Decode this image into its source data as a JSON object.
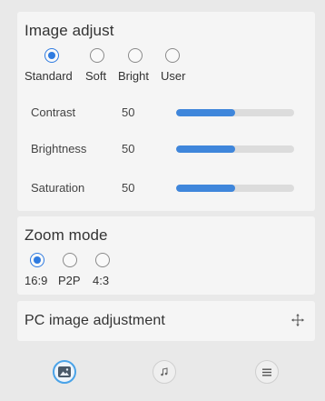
{
  "image_adjust": {
    "title": "Image adjust",
    "presets": [
      {
        "label": "Standard",
        "checked": true
      },
      {
        "label": "Soft",
        "checked": false
      },
      {
        "label": "Bright",
        "checked": false
      },
      {
        "label": "User",
        "checked": false
      }
    ],
    "sliders": [
      {
        "label": "Contrast",
        "value": "50",
        "fill_fraction": 0.5
      },
      {
        "label": "Brightness",
        "value": "50",
        "fill_fraction": 0.5
      },
      {
        "label": "Saturation",
        "value": "50",
        "fill_fraction": 0.5
      }
    ]
  },
  "zoom_mode": {
    "title": "Zoom mode",
    "options": [
      {
        "label": "16:9",
        "checked": true
      },
      {
        "label": "P2P",
        "checked": false
      },
      {
        "label": "4:3",
        "checked": false
      }
    ]
  },
  "pc_adjust": {
    "title": "PC image adjustment",
    "icon": "move-icon"
  },
  "bottom_tabs": [
    {
      "icon": "image-icon",
      "active": true
    },
    {
      "icon": "music-icon",
      "active": false
    },
    {
      "icon": "menu-icon",
      "active": false
    }
  ],
  "colors": {
    "accent": "#2f7be0",
    "slider_fill": "#3f86db",
    "track": "#dcdcdc",
    "card_bg": "#f5f5f5",
    "page_bg": "#e9e9e9"
  }
}
